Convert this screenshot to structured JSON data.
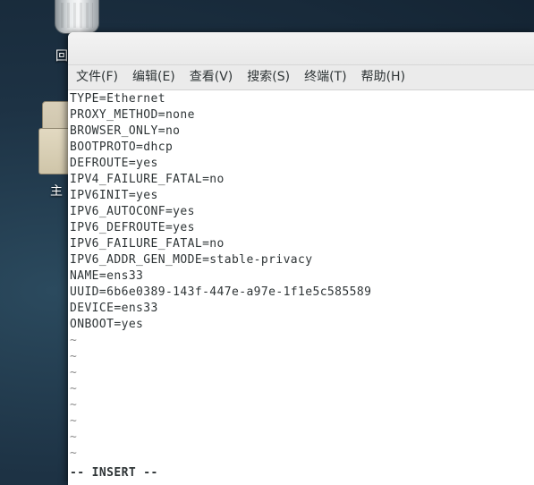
{
  "desktop": {
    "trash_label": "回",
    "home_label": "主"
  },
  "menu": [
    "文件(F)",
    "编辑(E)",
    "查看(V)",
    "搜索(S)",
    "终端(T)",
    "帮助(H)"
  ],
  "file_lines": [
    "TYPE=Ethernet",
    "PROXY_METHOD=none",
    "BROWSER_ONLY=no",
    "BOOTPROTO=dhcp",
    "DEFROUTE=yes",
    "IPV4_FAILURE_FATAL=no",
    "IPV6INIT=yes",
    "IPV6_AUTOCONF=yes",
    "IPV6_DEFROUTE=yes",
    "IPV6_FAILURE_FATAL=no",
    "IPV6_ADDR_GEN_MODE=stable-privacy",
    "NAME=ens33",
    "UUID=6b6e0389-143f-447e-a97e-1f1e5c585589",
    "DEVICE=ens33",
    "ONBOOT=yes"
  ],
  "empty_line_marker": "~",
  "empty_line_count": 8,
  "status_line": "-- INSERT --"
}
